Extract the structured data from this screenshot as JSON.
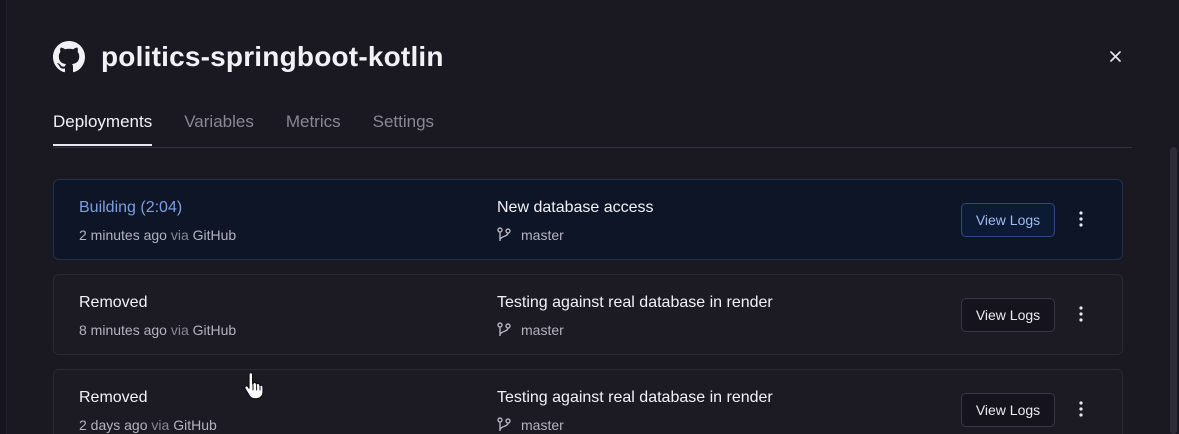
{
  "title": "politics-springboot-kotlin",
  "icons": {
    "logo": "github-icon",
    "close": "close-icon",
    "branch": "git-branch-icon",
    "more": "more-vertical-icon"
  },
  "tabs": [
    {
      "label": "Deployments",
      "active": true
    },
    {
      "label": "Variables",
      "active": false
    },
    {
      "label": "Metrics",
      "active": false
    },
    {
      "label": "Settings",
      "active": false
    }
  ],
  "deployments": [
    {
      "status": "Building (2:04)",
      "time": "2 minutes ago",
      "via": "via",
      "source": "GitHub",
      "message": "New database access",
      "branch": "master",
      "button": "View Logs"
    },
    {
      "status": "Removed",
      "time": "8 minutes ago",
      "via": "via",
      "source": "GitHub",
      "message": "Testing against real database in render",
      "branch": "master",
      "button": "View Logs"
    },
    {
      "status": "Removed",
      "time": "2 days ago",
      "via": "via",
      "source": "GitHub",
      "message": "Testing against real database in render",
      "branch": "master",
      "button": "View Logs"
    }
  ],
  "colors": {
    "background": "#1a1821",
    "active_card": "#0d1527",
    "accent": "#7d9fe0"
  }
}
